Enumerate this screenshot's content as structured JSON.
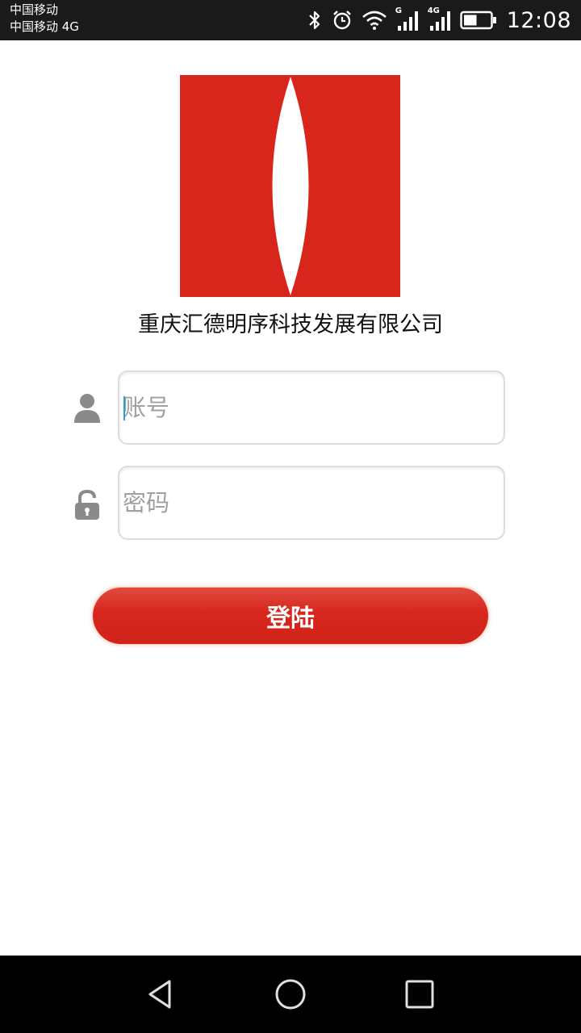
{
  "status_bar": {
    "carrier_line1": "中国移动",
    "carrier_line2": "中国移动 4G",
    "net_g_label": "G",
    "net_4g_label": "4G",
    "time": "12:08",
    "icons": [
      "bluetooth-icon",
      "alarm-icon",
      "wifi-icon",
      "signal-g-icon",
      "signal-4g-icon",
      "battery-icon"
    ],
    "battery_level": 0.5
  },
  "logo": {
    "colors": {
      "primary": "#d9261c",
      "accent": "#ffffff"
    }
  },
  "company_name": "重庆汇德明序科技发展有限公司",
  "form": {
    "account": {
      "placeholder": "账号",
      "value": "",
      "icon": "user-icon"
    },
    "password": {
      "placeholder": "密码",
      "value": "",
      "icon": "lock-icon"
    },
    "login_label": "登陆"
  },
  "nav_bar": {
    "buttons": [
      "back-icon",
      "home-icon",
      "recents-icon"
    ]
  },
  "colors": {
    "accent": "#d9261c",
    "status_bar": "#1a1a1a",
    "nav_bar": "#000000"
  }
}
